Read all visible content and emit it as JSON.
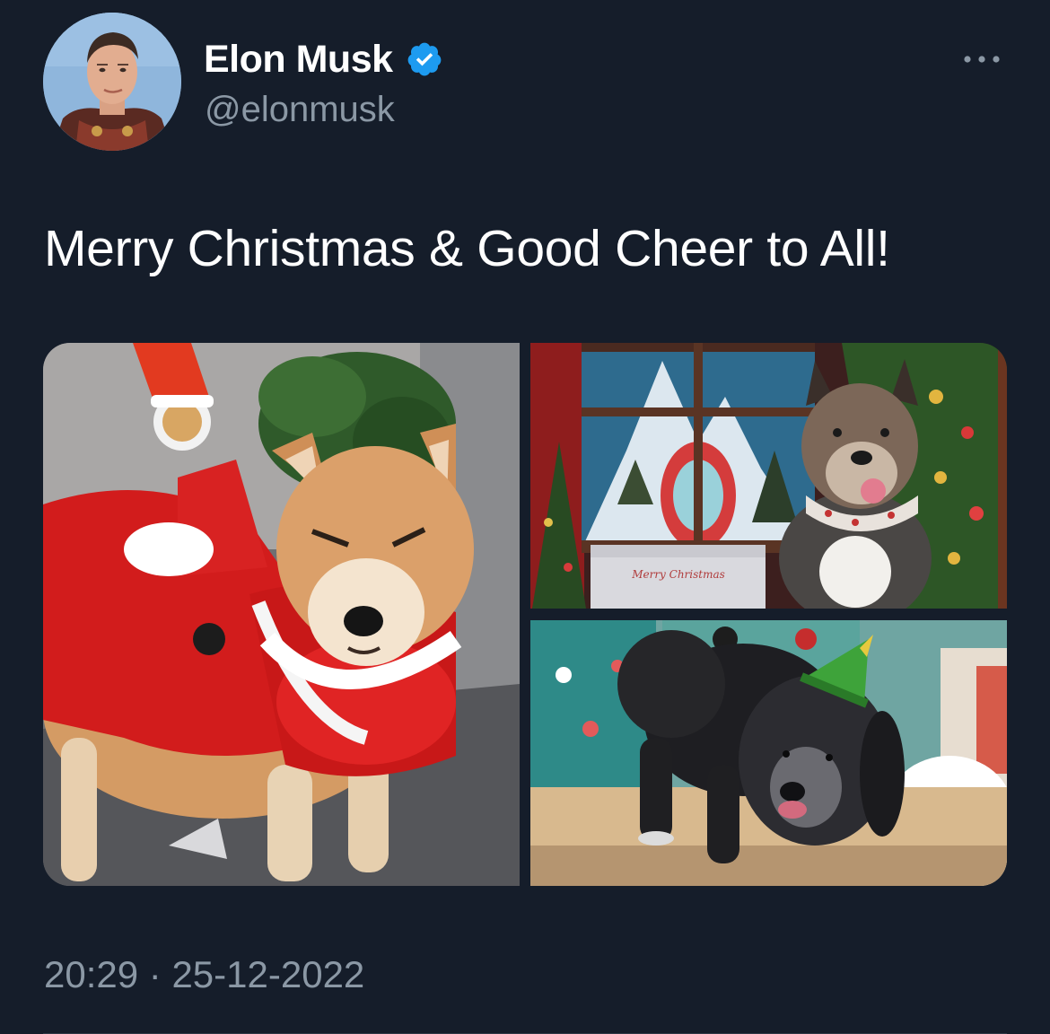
{
  "tweet": {
    "display_name": "Elon Musk",
    "handle": "@elonmusk",
    "verified": true,
    "verified_icon": "verified-badge-icon",
    "more_icon": "more-options-icon",
    "text": "Merry Christmas & Good Cheer to All!",
    "time": "20:29",
    "separator": "·",
    "date": "25-12-2022",
    "box_text": "Merry Christmas"
  },
  "colors": {
    "background": "#151d2a",
    "primary_text": "#ffffff",
    "secondary_text": "#8b98a5",
    "verified_blue": "#1d9bf0"
  }
}
